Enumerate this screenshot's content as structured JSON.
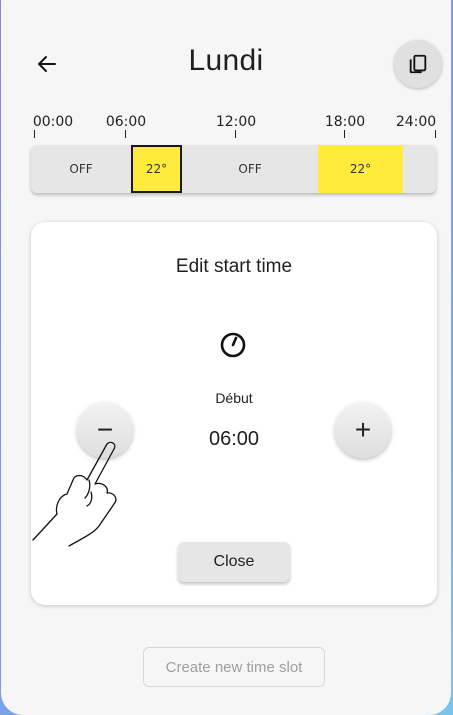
{
  "header": {
    "title": "Lundi",
    "back_icon": "arrow-left-icon",
    "copy_icon": "copy-icon"
  },
  "timeline": {
    "ticks": [
      "00:00",
      "06:00",
      "12:00",
      "18:00",
      "24:00"
    ],
    "segments": [
      {
        "label": "OFF",
        "highlight": false,
        "selected": false
      },
      {
        "label": "22°",
        "highlight": true,
        "selected": true
      },
      {
        "label": "OFF",
        "highlight": false,
        "selected": false
      },
      {
        "label": "22°",
        "highlight": true,
        "selected": false
      }
    ],
    "highlight_color": "#ffeb3b"
  },
  "editor": {
    "title": "Edit start time",
    "clock_icon": "clock-icon",
    "field_label": "Début",
    "value": "06:00",
    "minus_label": "−",
    "plus_label": "+",
    "close_label": "Close"
  },
  "footer": {
    "create_label": "Create new time slot"
  },
  "overlay": {
    "gesture_icon": "pointing-hand-icon"
  }
}
